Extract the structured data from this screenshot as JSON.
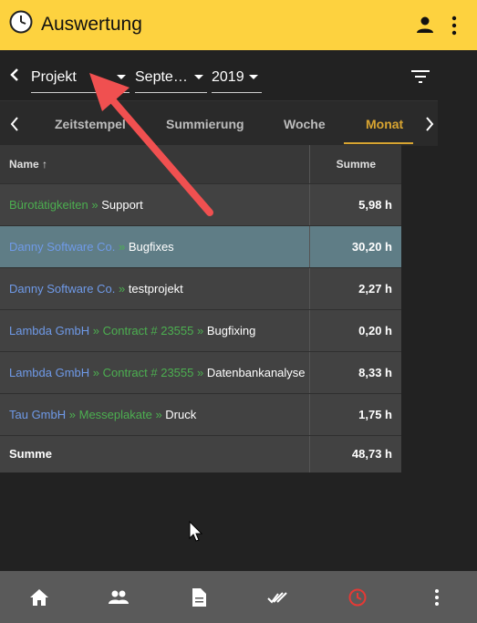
{
  "app": {
    "title": "Auswertung",
    "accent": "#fdd23f"
  },
  "filters": {
    "project": "Projekt",
    "month": "Septe…",
    "year": "2019"
  },
  "tabs": [
    {
      "label": "Zeitstempel"
    },
    {
      "label": "Summierung"
    },
    {
      "label": "Woche"
    },
    {
      "label": "Monat",
      "active": true
    }
  ],
  "table": {
    "headers": {
      "name": "Name ↑",
      "sum": "Summe"
    },
    "rows": [
      {
        "parts": [
          {
            "t": "Bürotätigkeiten",
            "c": "green"
          },
          {
            "t": " » ",
            "c": "green"
          },
          {
            "t": "Support",
            "c": "white"
          }
        ],
        "sum": "5,98 h"
      },
      {
        "parts": [
          {
            "t": "Danny Software Co.",
            "c": "blue"
          },
          {
            "t": " » ",
            "c": "green"
          },
          {
            "t": "Bugfixes",
            "c": "white"
          }
        ],
        "sum": "30,20 h",
        "selected": true
      },
      {
        "parts": [
          {
            "t": "Danny Software Co.",
            "c": "blue"
          },
          {
            "t": " » ",
            "c": "green"
          },
          {
            "t": "testprojekt",
            "c": "white"
          }
        ],
        "sum": "2,27 h"
      },
      {
        "parts": [
          {
            "t": "Lambda GmbH",
            "c": "blue"
          },
          {
            "t": " » ",
            "c": "green"
          },
          {
            "t": "Contract # 23555",
            "c": "green"
          },
          {
            "t": " » ",
            "c": "green"
          },
          {
            "t": "Bugfixing",
            "c": "white"
          }
        ],
        "sum": "0,20 h"
      },
      {
        "parts": [
          {
            "t": "Lambda GmbH",
            "c": "blue"
          },
          {
            "t": " » ",
            "c": "green"
          },
          {
            "t": "Contract # 23555",
            "c": "green"
          },
          {
            "t": " » ",
            "c": "green"
          },
          {
            "t": "Datenbankanalyse",
            "c": "white"
          }
        ],
        "sum": "8,33 h"
      },
      {
        "parts": [
          {
            "t": "Tau GmbH",
            "c": "blue"
          },
          {
            "t": " » ",
            "c": "green"
          },
          {
            "t": "Messeplakate",
            "c": "green"
          },
          {
            "t": " » ",
            "c": "green"
          },
          {
            "t": "Druck",
            "c": "white"
          }
        ],
        "sum": "1,75 h"
      }
    ],
    "total": {
      "label": "Summe",
      "sum": "48,73 h"
    }
  },
  "bottom_nav": [
    {
      "icon": "home-icon"
    },
    {
      "icon": "people-icon"
    },
    {
      "icon": "document-icon"
    },
    {
      "icon": "done-all-icon"
    },
    {
      "icon": "clock-icon",
      "active": true,
      "color": "#e53935"
    },
    {
      "icon": "more-vert-icon"
    }
  ]
}
